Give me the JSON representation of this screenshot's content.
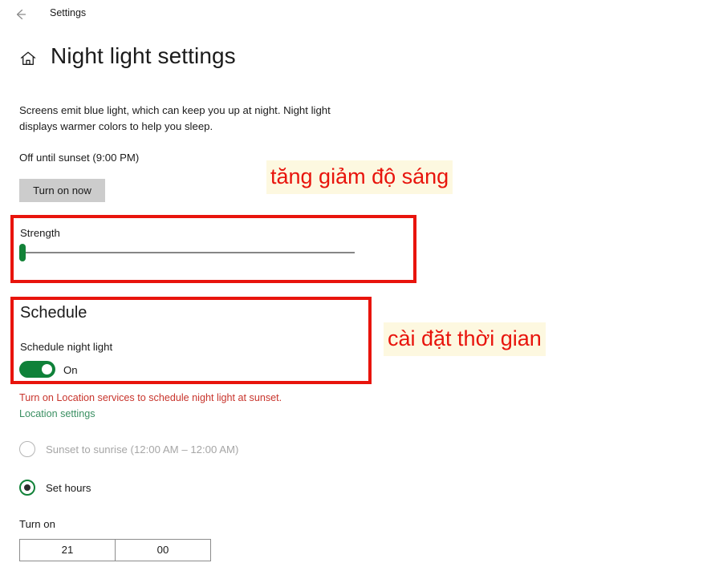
{
  "titlebar": {
    "back_icon": "back-arrow-icon",
    "label": "Settings"
  },
  "header": {
    "home_icon": "home-icon",
    "title": "Night light settings"
  },
  "description": "Screens emit blue light, which can keep you up at night. Night light displays warmer colors to help you sleep.",
  "status": {
    "text": "Off until sunset (9:00 PM)",
    "button_label": "Turn on now"
  },
  "strength": {
    "label": "Strength",
    "value": 0,
    "min": 0,
    "max": 100
  },
  "schedule": {
    "heading": "Schedule",
    "sublabel": "Schedule night light",
    "toggle_state": "On",
    "toggle_on": true,
    "location_warning": "Turn on Location services to schedule night light at sunset.",
    "location_link": "Location settings",
    "options": [
      {
        "label": "Sunset to sunrise (12:00 AM – 12:00 AM)",
        "selected": false,
        "disabled": true
      },
      {
        "label": "Set hours",
        "selected": true,
        "disabled": false
      }
    ]
  },
  "turn_on": {
    "label": "Turn on",
    "hours": "21",
    "minutes": "00"
  },
  "annotations": [
    {
      "text": "tăng giảm độ sáng"
    },
    {
      "text": "cài đặt thời gian"
    }
  ],
  "colors": {
    "highlight_box": "#e8140c",
    "annotation_text": "#e8140c",
    "annotation_background": "#fdf8e0",
    "accent_green": "#0f8139",
    "warning_red": "#c8342c",
    "link_green": "#3a8f62"
  }
}
